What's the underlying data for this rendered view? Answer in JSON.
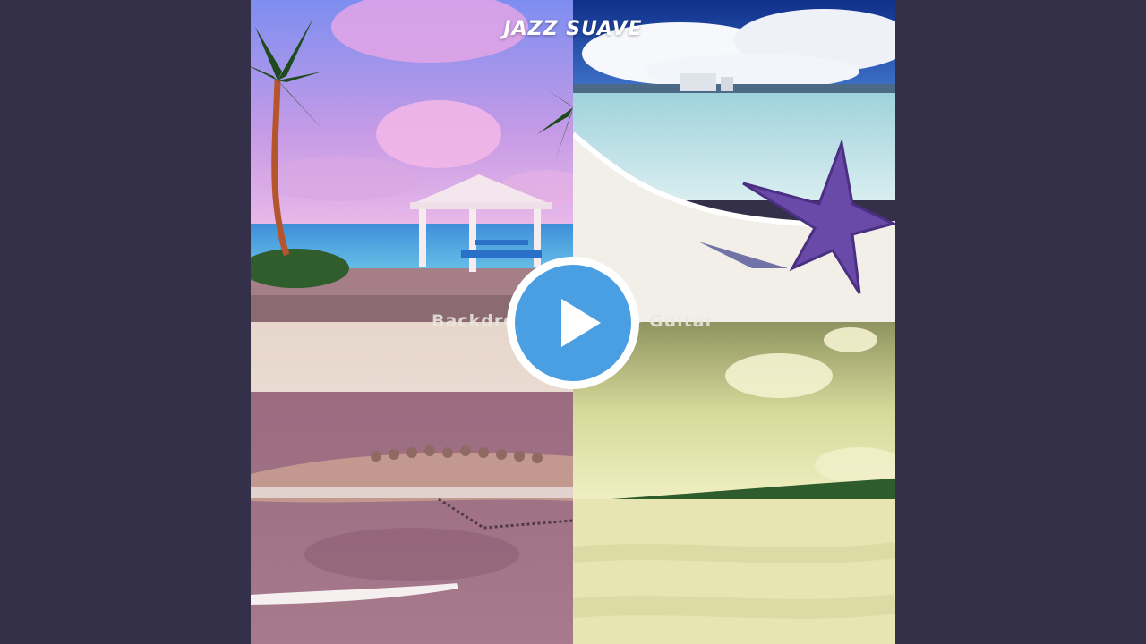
{
  "video": {
    "artist": "JAZZ SUAVE",
    "title": "Backdrop for ... ile - Guitar"
  },
  "player": {
    "play_icon": "play-icon",
    "accent_color": "#4a9fe3",
    "background_color": "#34304a"
  }
}
